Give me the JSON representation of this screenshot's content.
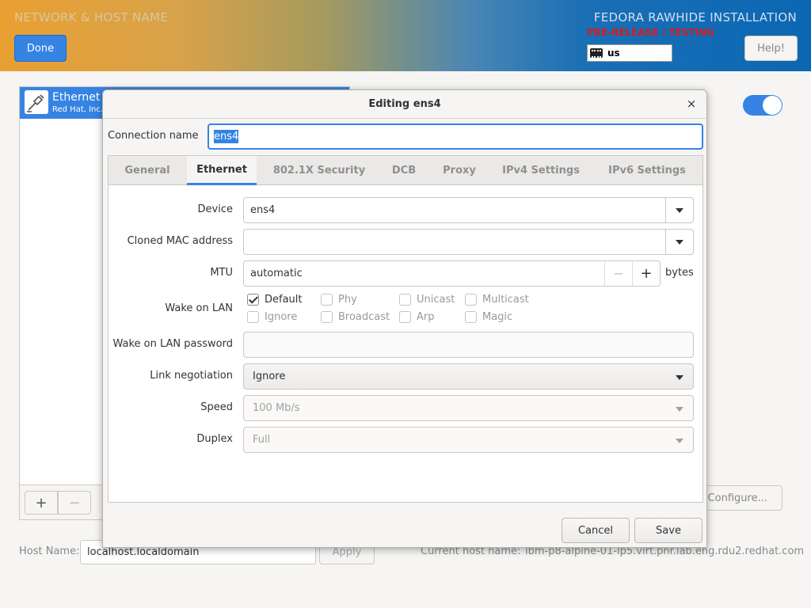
{
  "header": {
    "spoke_title": "NETWORK & HOST NAME",
    "done_label": "Done",
    "product_title": "FEDORA RAWHIDE INSTALLATION",
    "prerelease": "PRE-RELEASE / TESTING",
    "keyboard_layout": "us",
    "help_label": "Help!"
  },
  "device_list": {
    "selected": {
      "name": "Ethernet",
      "vendor": "Red Hat, Inc. V"
    },
    "add_label": "+",
    "remove_label": "−"
  },
  "configure_label": "Configure...",
  "hostname": {
    "label": "Host Name:",
    "value": "localhost.localdomain",
    "apply_label": "Apply",
    "current_label": "Current host name:",
    "current_value": "ibm-p8-alpine-01-lp5.virt.pnr.lab.eng.rdu2.redhat.com"
  },
  "dialog": {
    "title": "Editing ens4",
    "close_glyph": "×",
    "connection_name_label": "Connection name",
    "connection_name_value": "ens4",
    "tabs": [
      {
        "label": "General"
      },
      {
        "label": "Ethernet"
      },
      {
        "label": "802.1X Security"
      },
      {
        "label": "DCB"
      },
      {
        "label": "Proxy"
      },
      {
        "label": "IPv4 Settings"
      },
      {
        "label": "IPv6 Settings"
      }
    ],
    "active_tab": "Ethernet",
    "ethernet": {
      "device_label": "Device",
      "device_value": "ens4",
      "cloned_mac_label": "Cloned MAC address",
      "cloned_mac_value": "",
      "mtu_label": "MTU",
      "mtu_value": "automatic",
      "mtu_minus": "−",
      "mtu_plus": "+",
      "mtu_unit": "bytes",
      "wol_label": "Wake on LAN",
      "wol_options": [
        {
          "label": "Default",
          "checked": true
        },
        {
          "label": "Phy",
          "checked": false
        },
        {
          "label": "Unicast",
          "checked": false
        },
        {
          "label": "Multicast",
          "checked": false
        },
        {
          "label": "Ignore",
          "checked": false
        },
        {
          "label": "Broadcast",
          "checked": false
        },
        {
          "label": "Arp",
          "checked": false
        },
        {
          "label": "Magic",
          "checked": false
        }
      ],
      "wol_password_label": "Wake on LAN password",
      "wol_password_value": "",
      "link_negotiation_label": "Link negotiation",
      "link_negotiation_value": "Ignore",
      "speed_label": "Speed",
      "speed_value": "100 Mb/s",
      "duplex_label": "Duplex",
      "duplex_value": "Full"
    },
    "cancel_label": "Cancel",
    "save_label": "Save"
  },
  "colors": {
    "accent": "#3584e4",
    "prerelease": "#d81b1b"
  }
}
